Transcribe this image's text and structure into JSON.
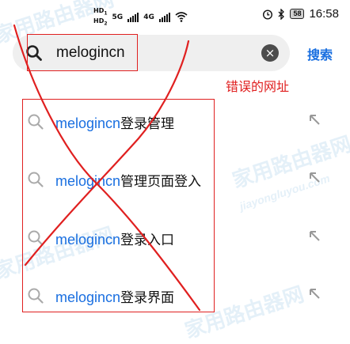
{
  "status_bar": {
    "hd1": "HD",
    "hd1_sub": "1",
    "hd2": "HD",
    "hd2_sub": "2",
    "net1": "5G",
    "net2": "4G",
    "battery": "58",
    "time": "16:58"
  },
  "search": {
    "query": "melogincn",
    "search_button": "搜索"
  },
  "annotation": "错误的网址",
  "suggestions": [
    {
      "keyword": "melogincn",
      "suffix": "登录管理"
    },
    {
      "keyword": "melogincn",
      "suffix": "管理页面登入"
    },
    {
      "keyword": "melogincn",
      "suffix": "登录入口"
    },
    {
      "keyword": "melogincn",
      "suffix": "登录界面"
    }
  ],
  "watermark": {
    "text": "家用路由器网",
    "url": "jiayongluyou.com"
  },
  "colors": {
    "accent": "#1a6fe0",
    "annotation_red": "#e02020",
    "search_bg": "#efefef"
  },
  "icons": [
    "search-icon",
    "clear-icon",
    "arrow-up-left-icon",
    "wifi-icon",
    "alarm-icon",
    "bluetooth-icon"
  ]
}
